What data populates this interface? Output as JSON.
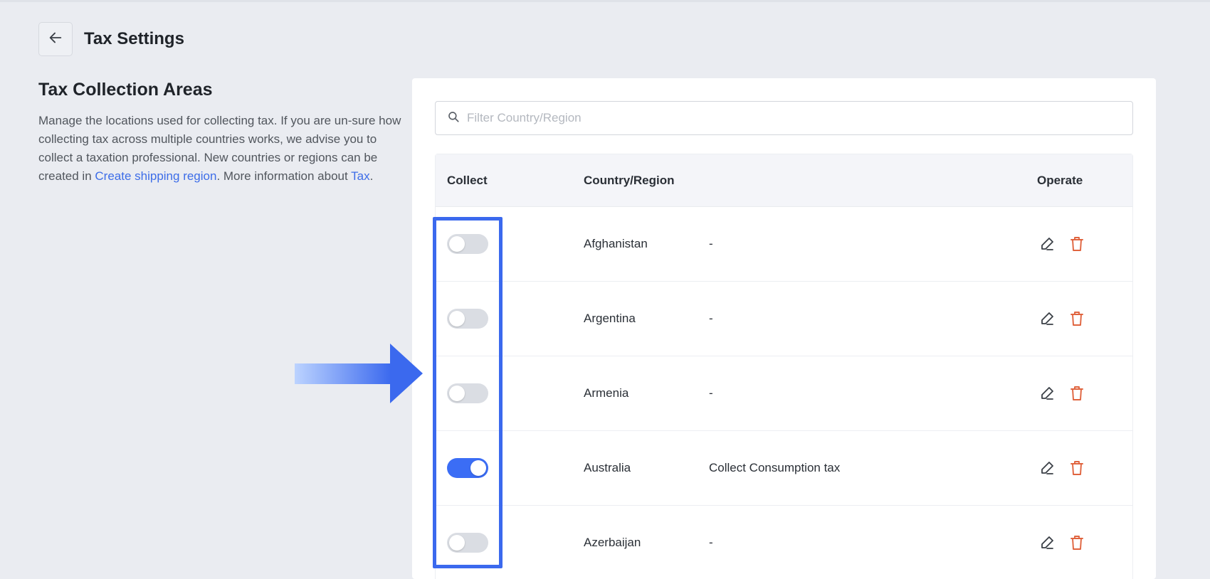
{
  "header": {
    "title": "Tax Settings"
  },
  "section": {
    "title": "Tax Collection Areas",
    "desc_part1": "Manage the locations used for collecting tax. If you are un-sure how collecting tax across multiple countries works, we advise you to collect a taxation professional. New countries or regions can be created in ",
    "link_shipping": "Create shipping region",
    "desc_part2": ". More information about ",
    "link_tax": "Tax",
    "desc_part3": "."
  },
  "search": {
    "placeholder": "Filter Country/Region",
    "value": ""
  },
  "table": {
    "columns": {
      "collect": "Collect",
      "country": "Country/Region",
      "operate": "Operate"
    },
    "rows": [
      {
        "country": "Afghanistan",
        "rule": "-",
        "collect": false
      },
      {
        "country": "Argentina",
        "rule": "-",
        "collect": false
      },
      {
        "country": "Armenia",
        "rule": "-",
        "collect": false
      },
      {
        "country": "Australia",
        "rule": "Collect Consumption tax",
        "collect": true
      },
      {
        "country": "Azerbaijan",
        "rule": "-",
        "collect": false
      }
    ]
  },
  "icons": {
    "back": "arrow-left-icon",
    "search": "search-icon",
    "edit": "pencil-icon",
    "delete": "trash-icon"
  },
  "colors": {
    "accent": "#3b6df5",
    "link": "#3d6de8",
    "delete": "#e0643f",
    "toggle_off": "#dadde3",
    "highlight": "#3b69ee"
  }
}
